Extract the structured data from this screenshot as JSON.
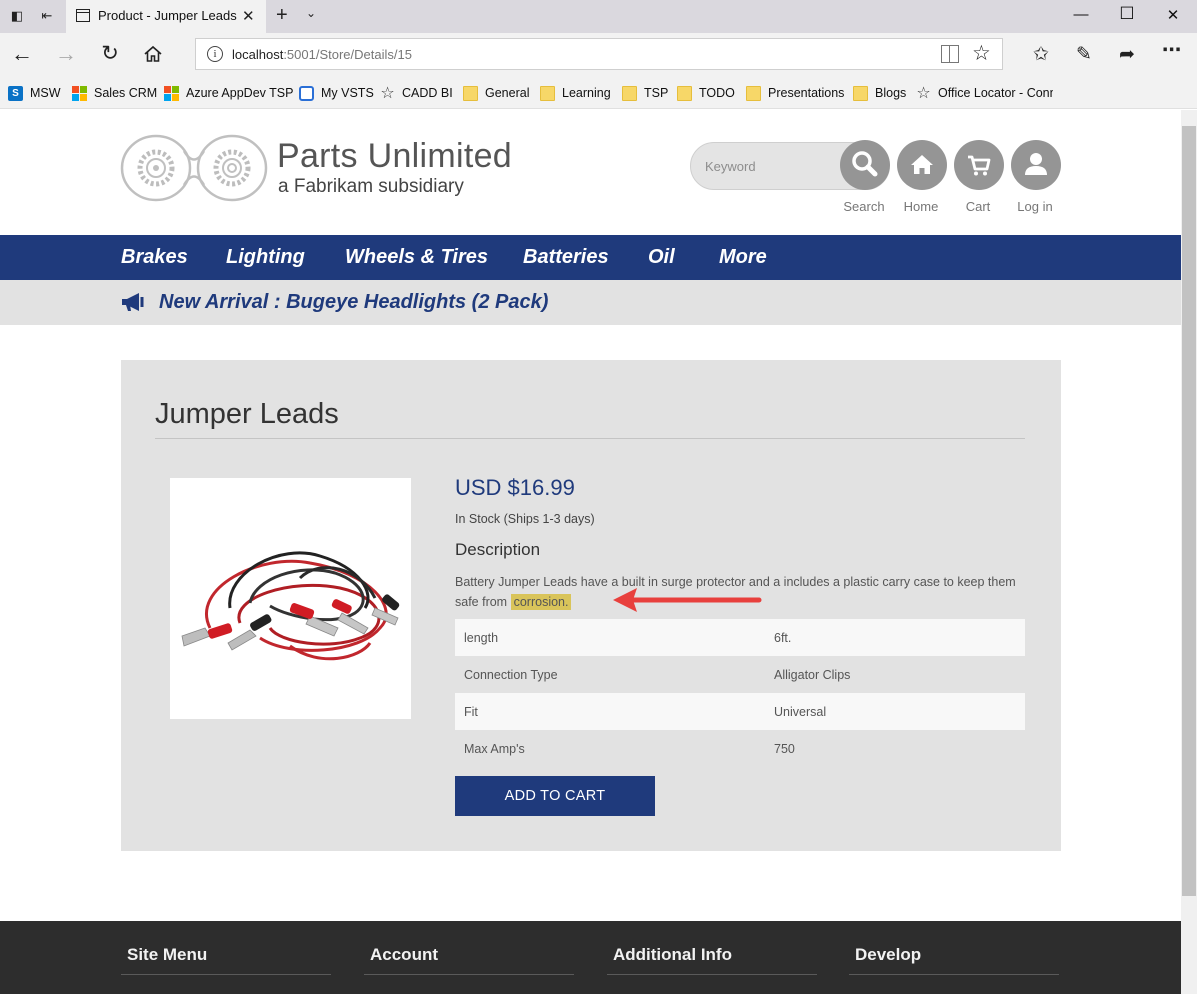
{
  "browser": {
    "tab_title": "Product - Jumper Leads",
    "url_host": "localhost",
    "url_path": ":5001/Store/Details/15",
    "favorites": [
      {
        "label": "MSW",
        "icon": "sharepoint-icon"
      },
      {
        "label": "Sales CRM",
        "icon": "microsoft-logo-icon"
      },
      {
        "label": "Azure AppDev TSP",
        "icon": "microsoft-logo-icon"
      },
      {
        "label": "My VSTS",
        "icon": "vsts-icon"
      },
      {
        "label": "CADD BI",
        "icon": "star-icon"
      },
      {
        "label": "General",
        "icon": "folder-icon"
      },
      {
        "label": "Learning",
        "icon": "folder-icon"
      },
      {
        "label": "TSP",
        "icon": "folder-icon"
      },
      {
        "label": "TODO",
        "icon": "folder-icon"
      },
      {
        "label": "Presentations",
        "icon": "folder-icon"
      },
      {
        "label": "Blogs",
        "icon": "folder-icon"
      },
      {
        "label": "Office Locator - Conn",
        "icon": "star-icon"
      }
    ]
  },
  "site": {
    "brand_title": "Parts Unlimited",
    "brand_subtitle": "a Fabrikam subsidiary",
    "search_placeholder": "Keyword",
    "header_buttons": {
      "search": "Search",
      "home": "Home",
      "cart": "Cart",
      "login": "Log in"
    },
    "nav": [
      "Brakes",
      "Lighting",
      "Wheels & Tires",
      "Batteries",
      "Oil",
      "More"
    ],
    "announcement": "New Arrival : Bugeye Headlights (2 Pack)",
    "colors": {
      "primary": "#1f3a7c",
      "panel": "#e2e2e2",
      "highlight": "#d9c45a",
      "annotation_arrow": "#e8403d"
    }
  },
  "product": {
    "title": "Jumper Leads",
    "price": "USD $16.99",
    "stock": "In Stock (Ships 1-3 days)",
    "description_heading": "Description",
    "description_before": "Battery Jumper Leads have a built in surge protector and a includes a plastic carry case to keep them safe from",
    "description_highlight": "corrosion.",
    "specs": [
      {
        "key": "length",
        "value": "6ft."
      },
      {
        "key": "Connection Type",
        "value": "Alligator Clips"
      },
      {
        "key": "Fit",
        "value": "Universal"
      },
      {
        "key": "Max Amp's",
        "value": "750"
      }
    ],
    "add_to_cart": "ADD TO CART"
  },
  "footer": {
    "columns": [
      "Site Menu",
      "Account",
      "Additional Info",
      "Develop"
    ]
  }
}
